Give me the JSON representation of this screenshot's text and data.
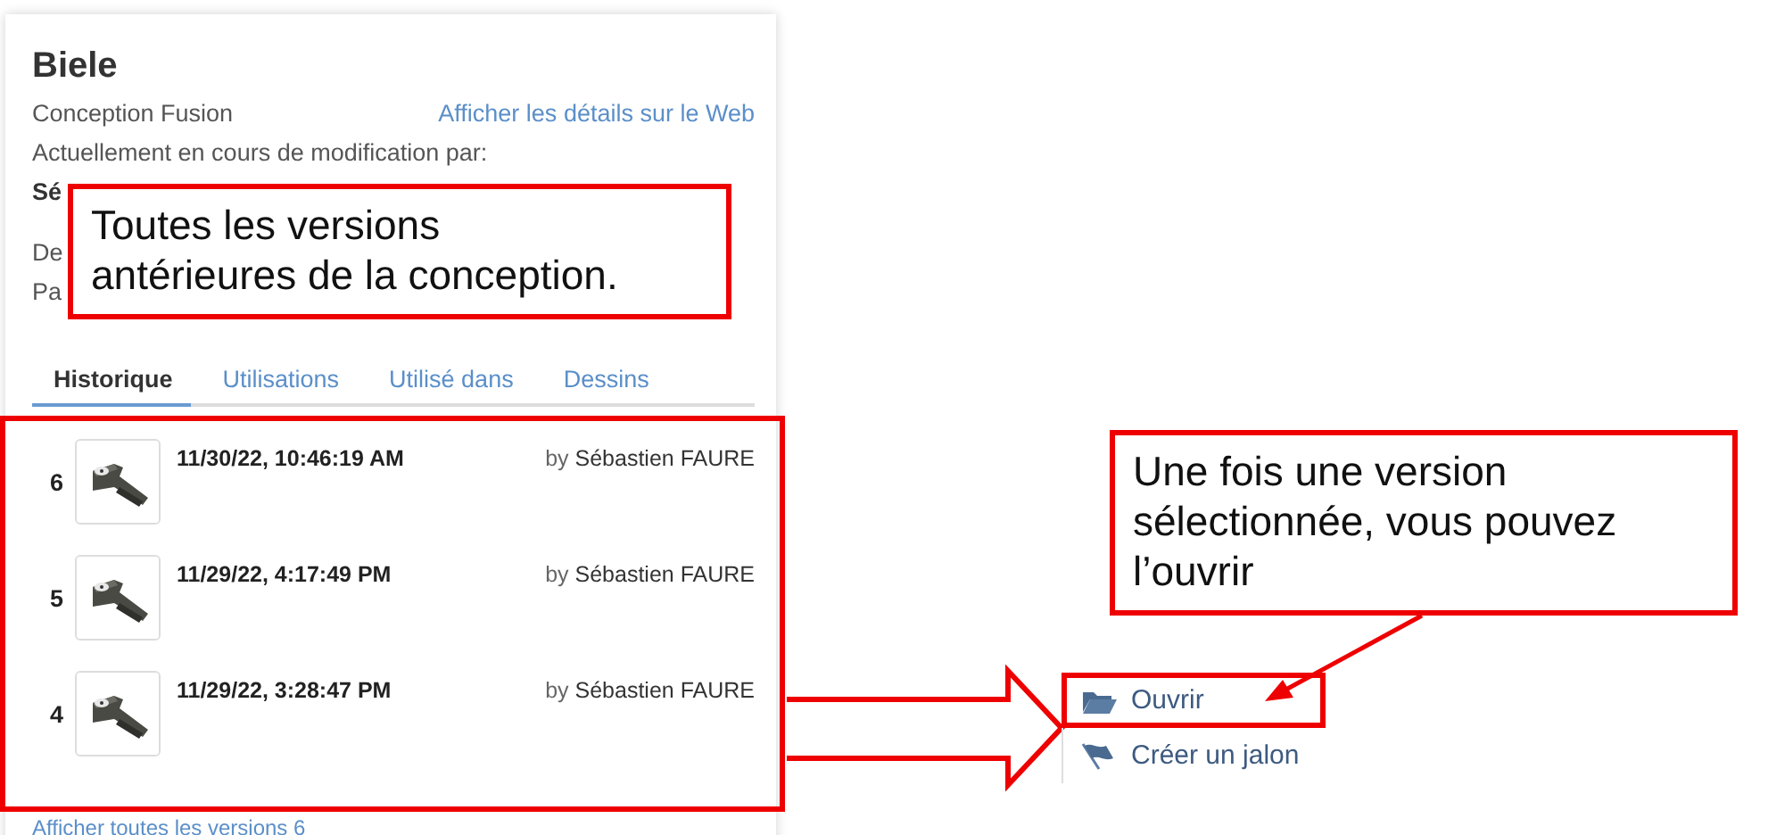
{
  "part": {
    "title": "Biele",
    "type": "Conception Fusion",
    "web_link": "Afficher les détails sur le Web",
    "editing_label": "Actuellement en cours de modification par:",
    "editor": "Sé",
    "line_1": "De",
    "line_2": "Pa"
  },
  "tabs": [
    {
      "label": "Historique",
      "selected": true
    },
    {
      "label": "Utilisations",
      "selected": false
    },
    {
      "label": "Utilisé dans",
      "selected": false
    },
    {
      "label": "Dessins",
      "selected": false
    }
  ],
  "versions": [
    {
      "number": "6",
      "date": "11/30/22, 10:46:19 AM",
      "by": "by",
      "author": "Sébastien FAURE"
    },
    {
      "number": "5",
      "date": "11/29/22, 4:17:49 PM",
      "by": "by",
      "author": "Sébastien FAURE"
    },
    {
      "number": "4",
      "date": "11/29/22, 3:28:47 PM",
      "by": "by",
      "author": "Sébastien FAURE"
    }
  ],
  "show_all_link": "Afficher toutes les versions 6",
  "actions": [
    {
      "label": "Ouvrir",
      "kind": "open",
      "highlighted": true
    },
    {
      "label": "Créer un jalon",
      "kind": "milestone",
      "highlighted": false
    }
  ],
  "callouts": [
    {
      "text": "Toutes les versions antérieures de la conception."
    },
    {
      "text": "Une fois une version sélectionnée, vous pouvez l’ouvrir"
    }
  ]
}
